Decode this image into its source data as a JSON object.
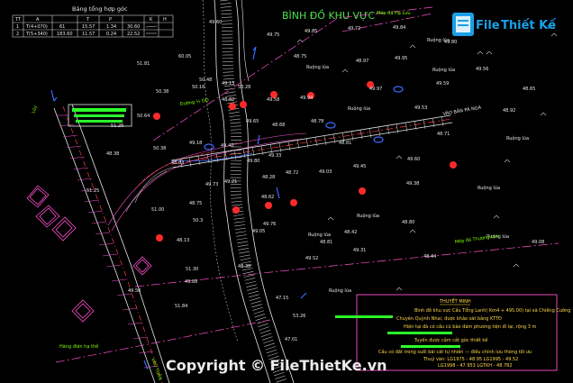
{
  "title": "BÌNH ĐỒ KHU VỰC",
  "table": {
    "title": "Bảng tổng hợp góc",
    "headers": [
      "TT",
      "A",
      "",
      "T",
      "P",
      "",
      "K",
      "H"
    ],
    "rows": [
      [
        "1",
        "T(4+070)",
        "61",
        "15.57",
        "1.34",
        "30.60",
        ""
      ],
      [
        "2",
        "T(5+340)",
        "183.60",
        "11.57",
        "0.24",
        "22.52",
        ""
      ]
    ]
  },
  "logo": {
    "brand_part1": "File",
    "brand_part2": "Thiết Kế",
    "brand_suffix": ".vn"
  },
  "labels": {
    "mep_ho_luu": "Mép đá Hạ Lưu",
    "mep_thuong_luu": "Mép đá Thượng Lưu",
    "vao_ban": "VÀO BẢN PÁ NGA",
    "hang_dien": "Hàng điện hạ thế",
    "route_left": "Lũy",
    "route_bottom": "VÀO TUẦN",
    "road_label": "Đường ½ ĐĐ",
    "rice": [
      "Ruộng lúa",
      "Ruộng lúa",
      "Ruộng lúa",
      "Ruộng lúa",
      "Ruộng lúa",
      "Ruộng lúa",
      "Ruộng lúa",
      "Ruộng lúa",
      "Ruộng lúa",
      "Ruộng lúa"
    ]
  },
  "notes": {
    "heading": "THUYẾT MINH",
    "lines": [
      "Bình đồ khu vực Cầu Tổng Lanh( Km4 + 495.00) tại xã Chiềng Cường",
      "Chuyên Quỳnh Nhai, được khảo sát bằng KTTĐ",
      "Hiện tại đã có cầu cũ bảo đảm phương tiện đi lại, rộng 3 m",
      "Tuyến được cắm cắt góc thiết kế",
      "Cầu có đất trong suối bãi cát tự nhiên — điều chỉnh lưu thông tối ưu",
      "Thuỷ văn: LG1975 - 48.95    LG1995 - 49.52",
      "LG1998 - 47.953    LGTKH - 48.782"
    ]
  },
  "copyright": "Copyright © FileThietKe.vn",
  "elevations": [
    "49.75",
    "49.85",
    "49.72",
    "49.84",
    "49.80",
    "49.60",
    "60.05",
    "51.81",
    "48.75",
    "48.97",
    "49.95",
    "49.56",
    "50.38",
    "50.64",
    "48.82",
    "49.58",
    "50.48",
    "50.16",
    "49.13",
    "49.94",
    "49.97",
    "48.65",
    "48.92",
    "49.53",
    "51.26",
    "48.78",
    "49.65",
    "48.68",
    "50.38",
    "49.40",
    "49.18",
    "48.38",
    "48.83",
    "49.80",
    "49.33",
    "48.72",
    "49.60",
    "49.38",
    "49.45",
    "49.03",
    "48.28",
    "49.73",
    "49.21",
    "50.3",
    "48.75",
    "51.25",
    "48.62",
    "49.76",
    "51.00",
    "48.80",
    "48.42",
    "51.30",
    "47.15",
    "47.01",
    "48.38",
    "49.52",
    "51.84",
    "49.88",
    "49.50",
    "49.31",
    "53.28",
    "53.26",
    "48.81",
    "48.71",
    "49.59",
    "49.08",
    "48.81",
    "48.13",
    "48.44",
    "49.05"
  ]
}
